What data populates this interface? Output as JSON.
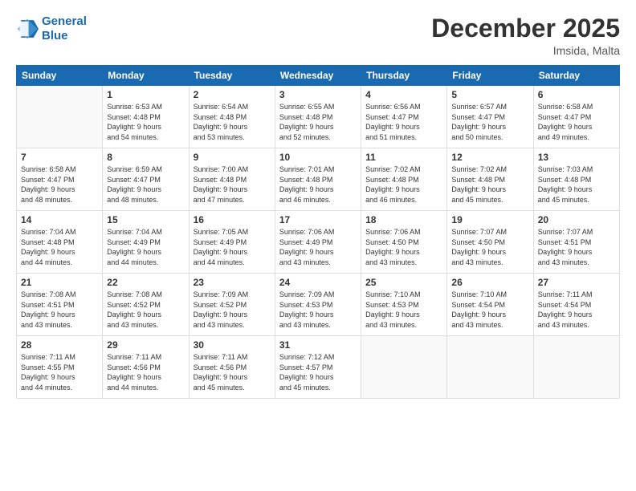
{
  "header": {
    "logo_line1": "General",
    "logo_line2": "Blue",
    "month": "December 2025",
    "location": "Imsida, Malta"
  },
  "weekdays": [
    "Sunday",
    "Monday",
    "Tuesday",
    "Wednesday",
    "Thursday",
    "Friday",
    "Saturday"
  ],
  "weeks": [
    [
      {
        "day": "",
        "info": ""
      },
      {
        "day": "1",
        "info": "Sunrise: 6:53 AM\nSunset: 4:48 PM\nDaylight: 9 hours\nand 54 minutes."
      },
      {
        "day": "2",
        "info": "Sunrise: 6:54 AM\nSunset: 4:48 PM\nDaylight: 9 hours\nand 53 minutes."
      },
      {
        "day": "3",
        "info": "Sunrise: 6:55 AM\nSunset: 4:48 PM\nDaylight: 9 hours\nand 52 minutes."
      },
      {
        "day": "4",
        "info": "Sunrise: 6:56 AM\nSunset: 4:47 PM\nDaylight: 9 hours\nand 51 minutes."
      },
      {
        "day": "5",
        "info": "Sunrise: 6:57 AM\nSunset: 4:47 PM\nDaylight: 9 hours\nand 50 minutes."
      },
      {
        "day": "6",
        "info": "Sunrise: 6:58 AM\nSunset: 4:47 PM\nDaylight: 9 hours\nand 49 minutes."
      }
    ],
    [
      {
        "day": "7",
        "info": "Sunrise: 6:58 AM\nSunset: 4:47 PM\nDaylight: 9 hours\nand 48 minutes."
      },
      {
        "day": "8",
        "info": "Sunrise: 6:59 AM\nSunset: 4:47 PM\nDaylight: 9 hours\nand 48 minutes."
      },
      {
        "day": "9",
        "info": "Sunrise: 7:00 AM\nSunset: 4:48 PM\nDaylight: 9 hours\nand 47 minutes."
      },
      {
        "day": "10",
        "info": "Sunrise: 7:01 AM\nSunset: 4:48 PM\nDaylight: 9 hours\nand 46 minutes."
      },
      {
        "day": "11",
        "info": "Sunrise: 7:02 AM\nSunset: 4:48 PM\nDaylight: 9 hours\nand 46 minutes."
      },
      {
        "day": "12",
        "info": "Sunrise: 7:02 AM\nSunset: 4:48 PM\nDaylight: 9 hours\nand 45 minutes."
      },
      {
        "day": "13",
        "info": "Sunrise: 7:03 AM\nSunset: 4:48 PM\nDaylight: 9 hours\nand 45 minutes."
      }
    ],
    [
      {
        "day": "14",
        "info": "Sunrise: 7:04 AM\nSunset: 4:48 PM\nDaylight: 9 hours\nand 44 minutes."
      },
      {
        "day": "15",
        "info": "Sunrise: 7:04 AM\nSunset: 4:49 PM\nDaylight: 9 hours\nand 44 minutes."
      },
      {
        "day": "16",
        "info": "Sunrise: 7:05 AM\nSunset: 4:49 PM\nDaylight: 9 hours\nand 44 minutes."
      },
      {
        "day": "17",
        "info": "Sunrise: 7:06 AM\nSunset: 4:49 PM\nDaylight: 9 hours\nand 43 minutes."
      },
      {
        "day": "18",
        "info": "Sunrise: 7:06 AM\nSunset: 4:50 PM\nDaylight: 9 hours\nand 43 minutes."
      },
      {
        "day": "19",
        "info": "Sunrise: 7:07 AM\nSunset: 4:50 PM\nDaylight: 9 hours\nand 43 minutes."
      },
      {
        "day": "20",
        "info": "Sunrise: 7:07 AM\nSunset: 4:51 PM\nDaylight: 9 hours\nand 43 minutes."
      }
    ],
    [
      {
        "day": "21",
        "info": "Sunrise: 7:08 AM\nSunset: 4:51 PM\nDaylight: 9 hours\nand 43 minutes."
      },
      {
        "day": "22",
        "info": "Sunrise: 7:08 AM\nSunset: 4:52 PM\nDaylight: 9 hours\nand 43 minutes."
      },
      {
        "day": "23",
        "info": "Sunrise: 7:09 AM\nSunset: 4:52 PM\nDaylight: 9 hours\nand 43 minutes."
      },
      {
        "day": "24",
        "info": "Sunrise: 7:09 AM\nSunset: 4:53 PM\nDaylight: 9 hours\nand 43 minutes."
      },
      {
        "day": "25",
        "info": "Sunrise: 7:10 AM\nSunset: 4:53 PM\nDaylight: 9 hours\nand 43 minutes."
      },
      {
        "day": "26",
        "info": "Sunrise: 7:10 AM\nSunset: 4:54 PM\nDaylight: 9 hours\nand 43 minutes."
      },
      {
        "day": "27",
        "info": "Sunrise: 7:11 AM\nSunset: 4:54 PM\nDaylight: 9 hours\nand 43 minutes."
      }
    ],
    [
      {
        "day": "28",
        "info": "Sunrise: 7:11 AM\nSunset: 4:55 PM\nDaylight: 9 hours\nand 44 minutes."
      },
      {
        "day": "29",
        "info": "Sunrise: 7:11 AM\nSunset: 4:56 PM\nDaylight: 9 hours\nand 44 minutes."
      },
      {
        "day": "30",
        "info": "Sunrise: 7:11 AM\nSunset: 4:56 PM\nDaylight: 9 hours\nand 45 minutes."
      },
      {
        "day": "31",
        "info": "Sunrise: 7:12 AM\nSunset: 4:57 PM\nDaylight: 9 hours\nand 45 minutes."
      },
      {
        "day": "",
        "info": ""
      },
      {
        "day": "",
        "info": ""
      },
      {
        "day": "",
        "info": ""
      }
    ]
  ]
}
